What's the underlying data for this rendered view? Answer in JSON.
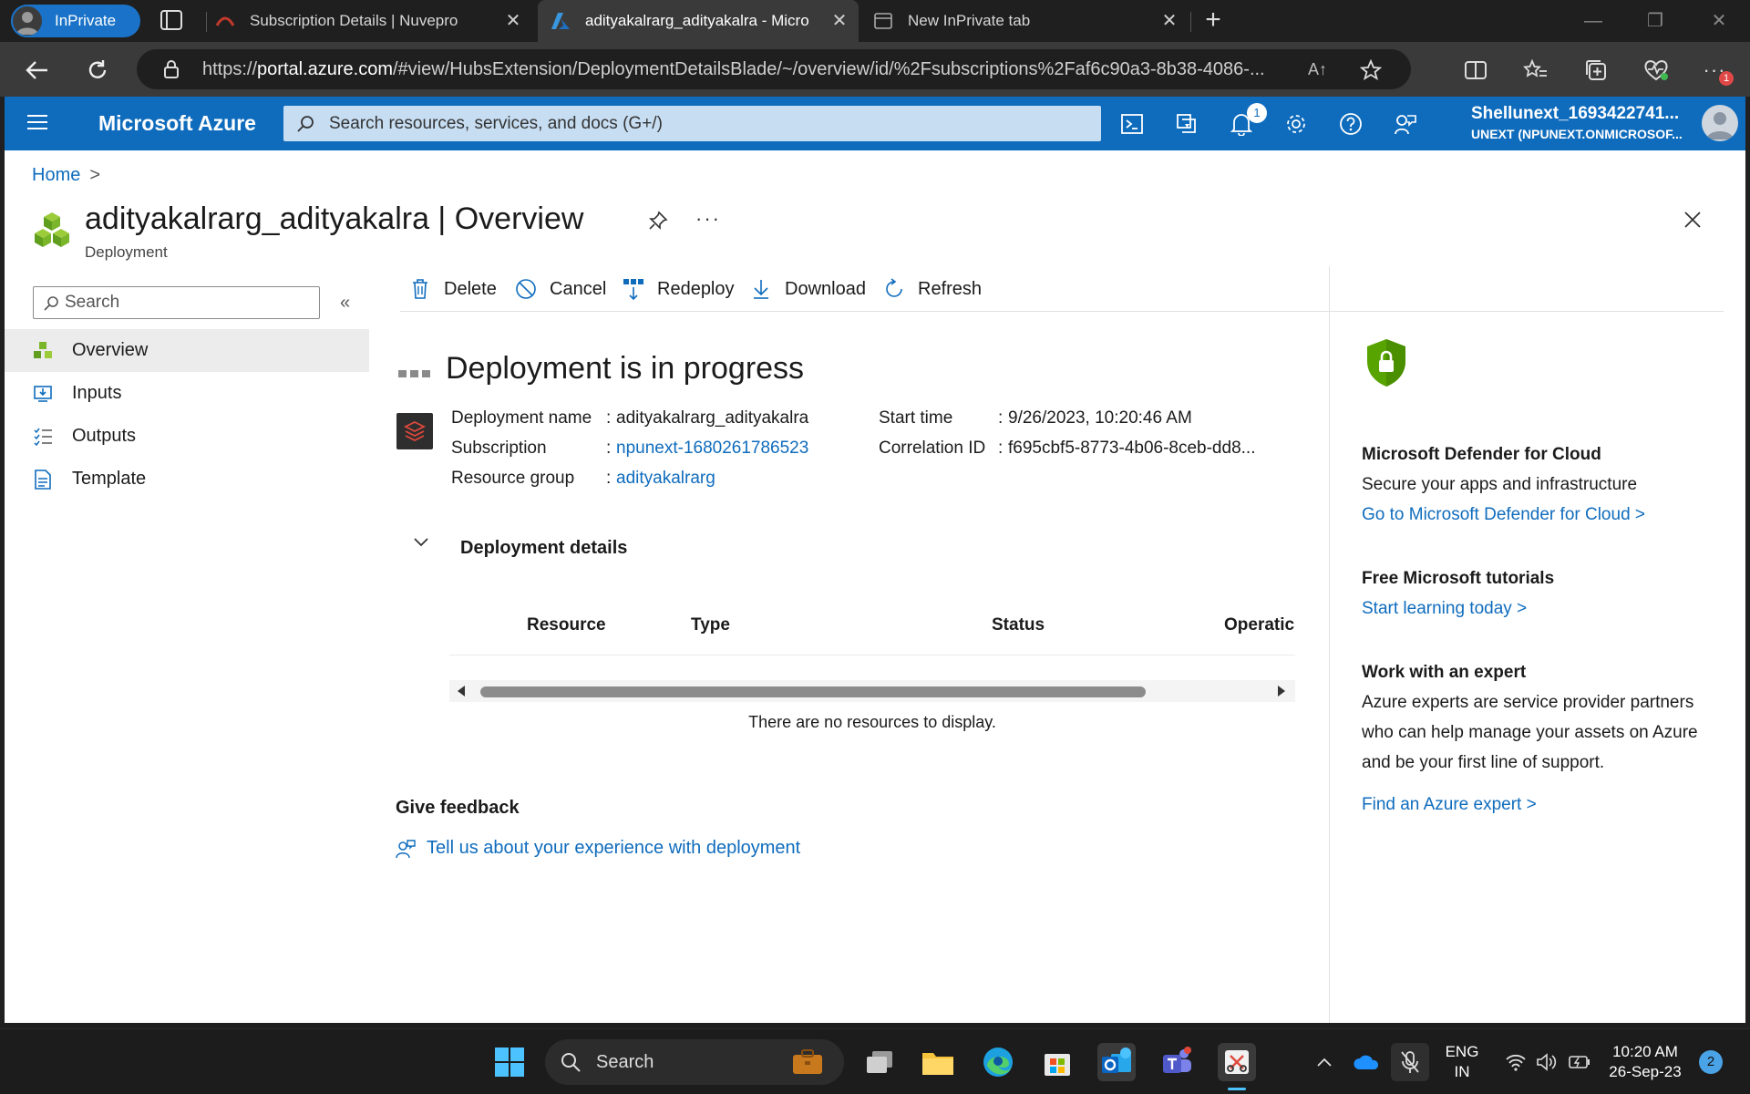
{
  "browser": {
    "inprivate_label": "InPrivate",
    "tabs": [
      {
        "title": "Subscription Details | Nuvepro"
      },
      {
        "title": "adityakalrarg_adityakalra - Micro"
      },
      {
        "title": "New InPrivate tab"
      }
    ],
    "url_prefix": "https://",
    "url_domain": "portal.azure.com",
    "url_path": "/#view/HubsExtension/DeploymentDetailsBlade/~/overview/id/%2Fsubscriptions%2Faf6c90a3-8b38-4086-...",
    "read_aloud": "A↑",
    "extensions_badge": "1"
  },
  "azure": {
    "brand": "Microsoft Azure",
    "search_placeholder": "Search resources, services, and docs (G+/)",
    "notification_count": "1",
    "user_name": "Shellunext_1693422741...",
    "tenant": "UNEXT (NPUNEXT.ONMICROSOF..."
  },
  "breadcrumb": {
    "home": "Home",
    "chevron": ">"
  },
  "blade": {
    "title_name": "adityakalrarg_adityakalra",
    "title_sep": " | ",
    "title_section": "Overview",
    "subtitle": "Deployment",
    "more": "···"
  },
  "sidebar": {
    "search_placeholder": "Search",
    "collapse": "«",
    "items": [
      {
        "label": "Overview",
        "selected": true
      },
      {
        "label": "Inputs"
      },
      {
        "label": "Outputs"
      },
      {
        "label": "Template"
      }
    ]
  },
  "commands": {
    "delete": "Delete",
    "cancel": "Cancel",
    "redeploy": "Redeploy",
    "download": "Download",
    "refresh": "Refresh"
  },
  "status": {
    "heading": "Deployment is in progress"
  },
  "essentials": {
    "deployment_name_label": "Deployment name",
    "deployment_name_value": "adityakalrarg_adityakalra",
    "subscription_label": "Subscription",
    "subscription_value": "npunext-1680261786523",
    "resource_group_label": "Resource group",
    "resource_group_value": "adityakalrarg",
    "start_time_label": "Start time",
    "start_time_value": "9/26/2023, 10:20:46 AM",
    "correlation_label": "Correlation ID",
    "correlation_value": "f695cbf5-8773-4b06-8ceb-dd8...",
    "colon": ":"
  },
  "details": {
    "section_title": "Deployment details",
    "columns": [
      "Resource",
      "Type",
      "Status",
      "Operatic"
    ],
    "empty_message": "There are no resources to display."
  },
  "feedback": {
    "title": "Give feedback",
    "link": "Tell us about your experience with deployment"
  },
  "right_panel": {
    "defender_title": "Microsoft Defender for Cloud",
    "defender_text": "Secure your apps and infrastructure",
    "defender_link": "Go to Microsoft Defender for Cloud >",
    "tutorials_title": "Free Microsoft tutorials",
    "tutorials_link": "Start learning today >",
    "expert_title": "Work with an expert",
    "expert_text": "Azure experts are service provider partners who can help manage your assets on Azure and be your first line of support.",
    "expert_link": "Find an Azure expert >"
  },
  "taskbar": {
    "search_label": "Search",
    "lang_line1": "ENG",
    "lang_line2": "IN",
    "time": "10:20 AM",
    "date": "26-Sep-23",
    "notification_count": "2"
  },
  "colors": {
    "azure_blue": "#0f6cbd",
    "shield_green": "#57a300"
  }
}
